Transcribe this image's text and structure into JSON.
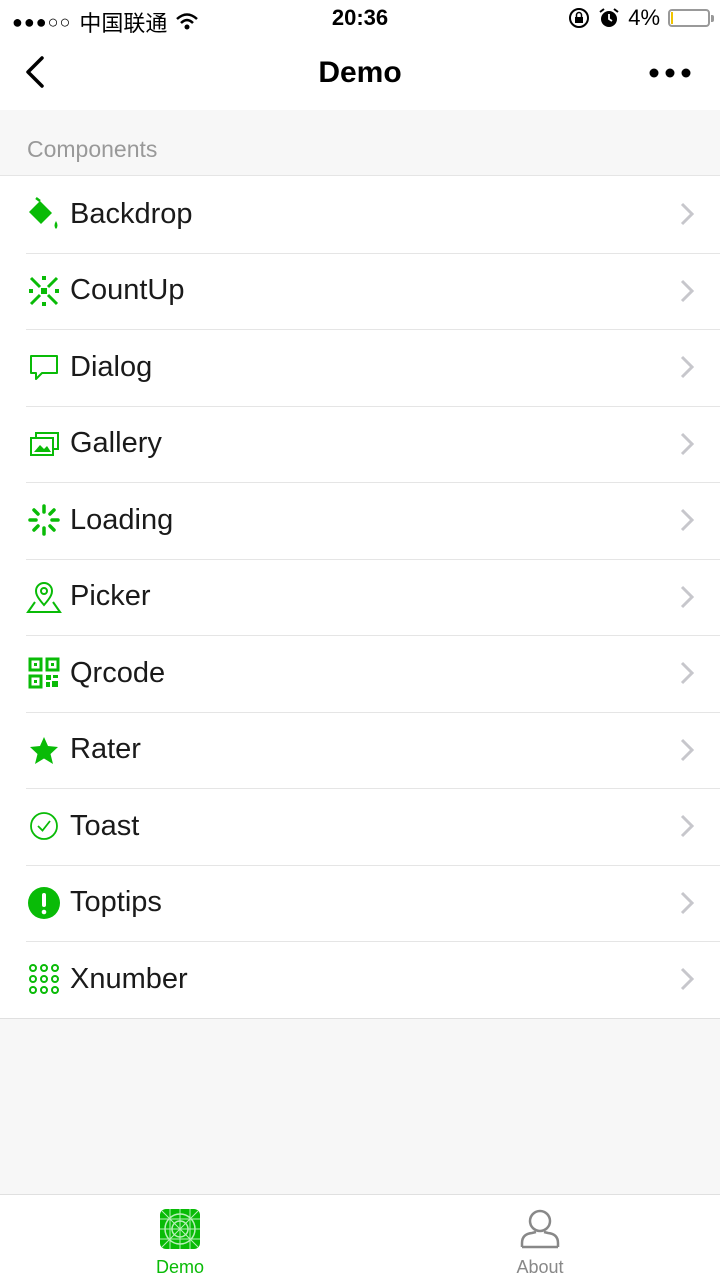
{
  "status_bar": {
    "signal": "●●●○○",
    "carrier": "中国联通",
    "time": "20:36",
    "battery_percent": "4%",
    "battery_level": 0.04
  },
  "nav": {
    "title": "Demo"
  },
  "section": {
    "title": "Components"
  },
  "items": [
    {
      "label": "Backdrop",
      "icon": "paint-bucket-icon"
    },
    {
      "label": "CountUp",
      "icon": "sparkle-icon"
    },
    {
      "label": "Dialog",
      "icon": "chat-bubble-icon"
    },
    {
      "label": "Gallery",
      "icon": "image-stack-icon"
    },
    {
      "label": "Loading",
      "icon": "spinner-icon"
    },
    {
      "label": "Picker",
      "icon": "map-pin-icon"
    },
    {
      "label": "Qrcode",
      "icon": "qrcode-icon"
    },
    {
      "label": "Rater",
      "icon": "star-icon"
    },
    {
      "label": "Toast",
      "icon": "check-circle-icon"
    },
    {
      "label": "Toptips",
      "icon": "exclamation-circle-icon"
    },
    {
      "label": "Xnumber",
      "icon": "dot-grid-icon"
    }
  ],
  "tabs": [
    {
      "label": "Demo",
      "active": true
    },
    {
      "label": "About",
      "active": false
    }
  ],
  "colors": {
    "accent": "#09bb07",
    "inactive": "#888888"
  }
}
